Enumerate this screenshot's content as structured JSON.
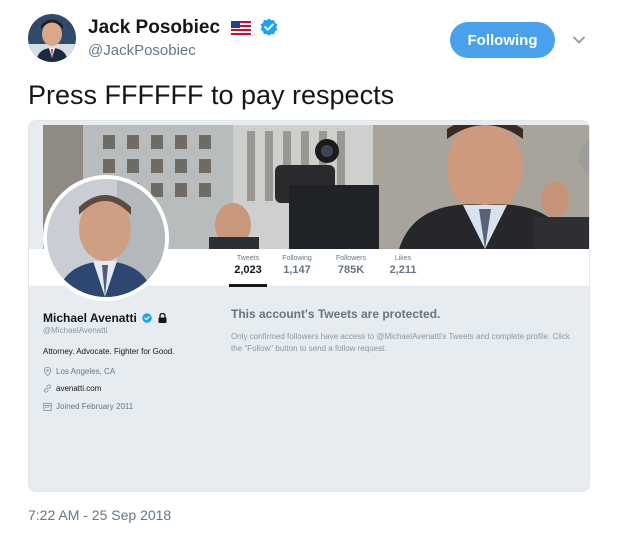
{
  "tweet": {
    "author_name": "Jack Posobiec",
    "author_handle": "@JackPosobiec",
    "follow_button_label": "Following",
    "text": "Press FFFFFF to pay respects",
    "timestamp": "7:22 AM - 25 Sep 2018",
    "colors": {
      "accent": "#4aa1eb",
      "verified": "#1da1f2"
    },
    "icons": [
      "us-flag-icon",
      "verified-badge-icon",
      "chevron-down-icon"
    ]
  },
  "embedded_profile": {
    "stats": [
      {
        "label": "Tweets",
        "value": "2,023"
      },
      {
        "label": "Following",
        "value": "1,147"
      },
      {
        "label": "Followers",
        "value": "785K"
      },
      {
        "label": "Likes",
        "value": "2,211"
      }
    ],
    "name": "Michael Avenatti",
    "handle": "@MichaelAvenatti",
    "bio": "Attorney. Advocate. Fighter for Good.",
    "location": "Los Angeles, CA",
    "website": "avenatti.com",
    "joined": "Joined February 2011",
    "protected_title": "This account's Tweets are protected.",
    "protected_body": "Only confirmed followers have access to @MichaelAvenatti's Tweets and complete profile. Click the \"Follow\" button to send a follow request.",
    "icons": [
      "verified-badge-icon",
      "lock-icon",
      "location-pin-icon",
      "link-icon",
      "calendar-icon"
    ]
  }
}
